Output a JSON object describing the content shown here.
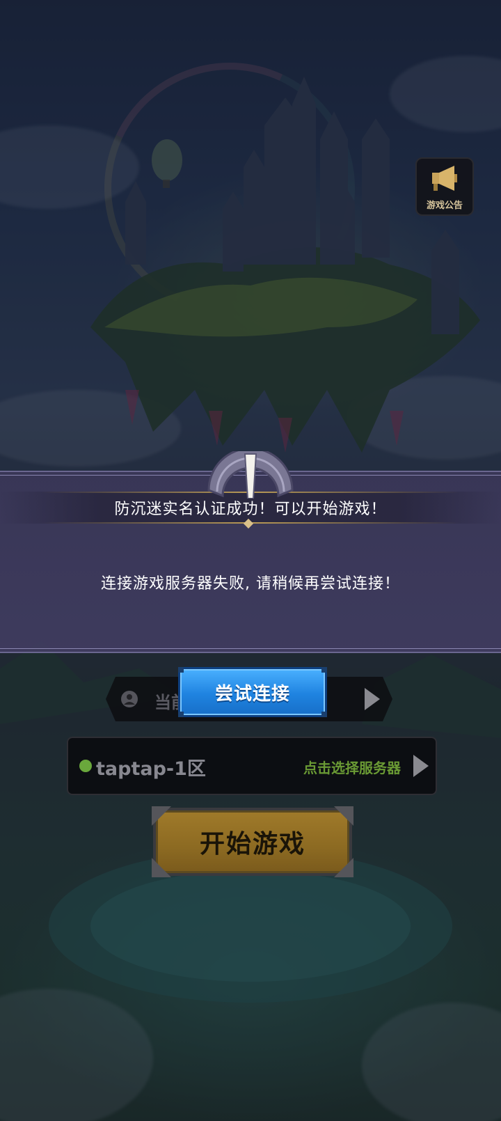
{
  "notice": {
    "label": "游戏公告",
    "icon": "megaphone-icon"
  },
  "dialog": {
    "title": "防沉迷实名认证成功！可以开始游戏！",
    "message": "连接游戏服务器失败, 请稍候再尝试连接！",
    "retry_label": "尝试连接"
  },
  "account": {
    "label": "当前",
    "icon": "user-avatar-icon"
  },
  "server": {
    "name": "taptap-1区",
    "status_color": "#6aa83c",
    "hint": "点击选择服务器"
  },
  "start": {
    "label": "开始游戏"
  },
  "colors": {
    "retry_blue": "#1f83e0",
    "start_gold": "#a07a2a",
    "dialog_bg": "#3a3758"
  }
}
